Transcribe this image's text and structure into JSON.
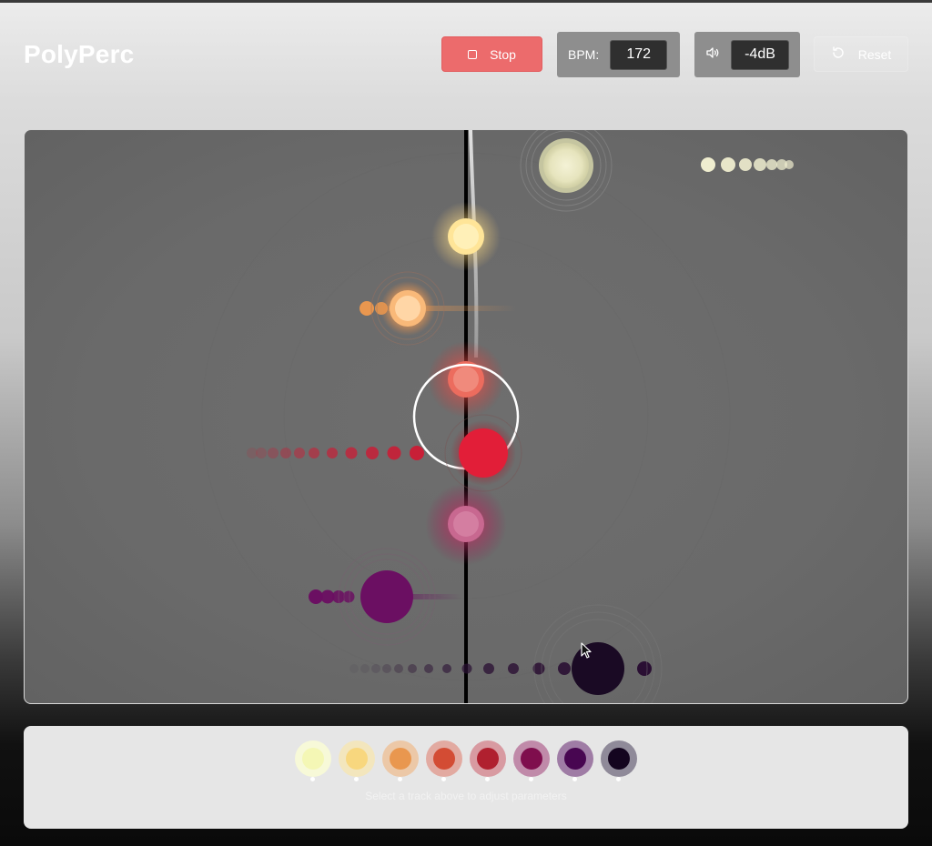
{
  "app": {
    "title": "PolyPerc"
  },
  "transport": {
    "stop_label": "Stop",
    "bpm_label": "BPM:",
    "bpm_value": "172",
    "volume_value": "-4dB",
    "reset_label": "Reset"
  },
  "icons": {
    "stop": "stop-square-icon",
    "volume": "speaker-volume-icon",
    "reset": "rotate-ccw-icon"
  },
  "colors": {
    "stop_button": "#ec6b6c",
    "canvas_bg": "#6b6b6b",
    "playhead": "#000000"
  },
  "tracks": [
    {
      "color": "#f4f7b5",
      "ring": "#f7f9d8"
    },
    {
      "color": "#f8d77e",
      "ring": "#f3e6bd"
    },
    {
      "color": "#e9974f",
      "ring": "#ecc8a7"
    },
    {
      "color": "#d34c34",
      "ring": "#e2aaa1"
    },
    {
      "color": "#b0202f",
      "ring": "#d89aa1"
    },
    {
      "color": "#7f0e4d",
      "ring": "#c08aa9"
    },
    {
      "color": "#480651",
      "ring": "#9f7ca5"
    },
    {
      "color": "#14051f",
      "ring": "#8f8a99"
    }
  ],
  "hint": "Select a track above to adjust parameters"
}
